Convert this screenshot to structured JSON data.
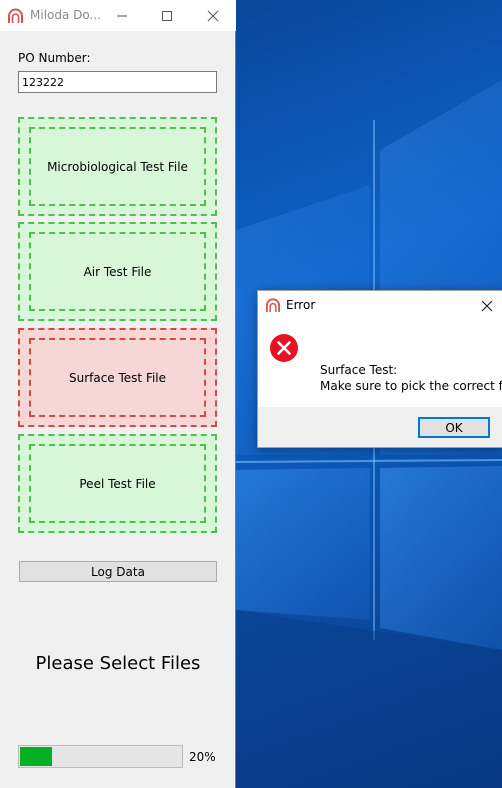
{
  "app": {
    "title": "Miloda Do...",
    "po_label": "PO Number:",
    "po_value": "123222",
    "drop_zones": [
      {
        "label": "Microbiological Test File",
        "state": "ok"
      },
      {
        "label": "Air Test File",
        "state": "ok"
      },
      {
        "label": "Surface Test File",
        "state": "error"
      },
      {
        "label": "Peel Test File",
        "state": "ok"
      }
    ],
    "log_button": "Log Data",
    "status_text": "Please Select Files",
    "progress": {
      "value_percent": 20,
      "label": "20%"
    },
    "colors": {
      "ok_fill": "#d8f7d8",
      "ok_border": "#4cc24c",
      "error_fill": "#f7d6d6",
      "error_border": "#d44a4a",
      "progress": "#06b025"
    }
  },
  "dialog": {
    "title": "Error",
    "message_line1": "Surface Test:",
    "message_line2": "Make sure to pick the correct file",
    "ok_label": "OK",
    "icon": "error-icon"
  }
}
